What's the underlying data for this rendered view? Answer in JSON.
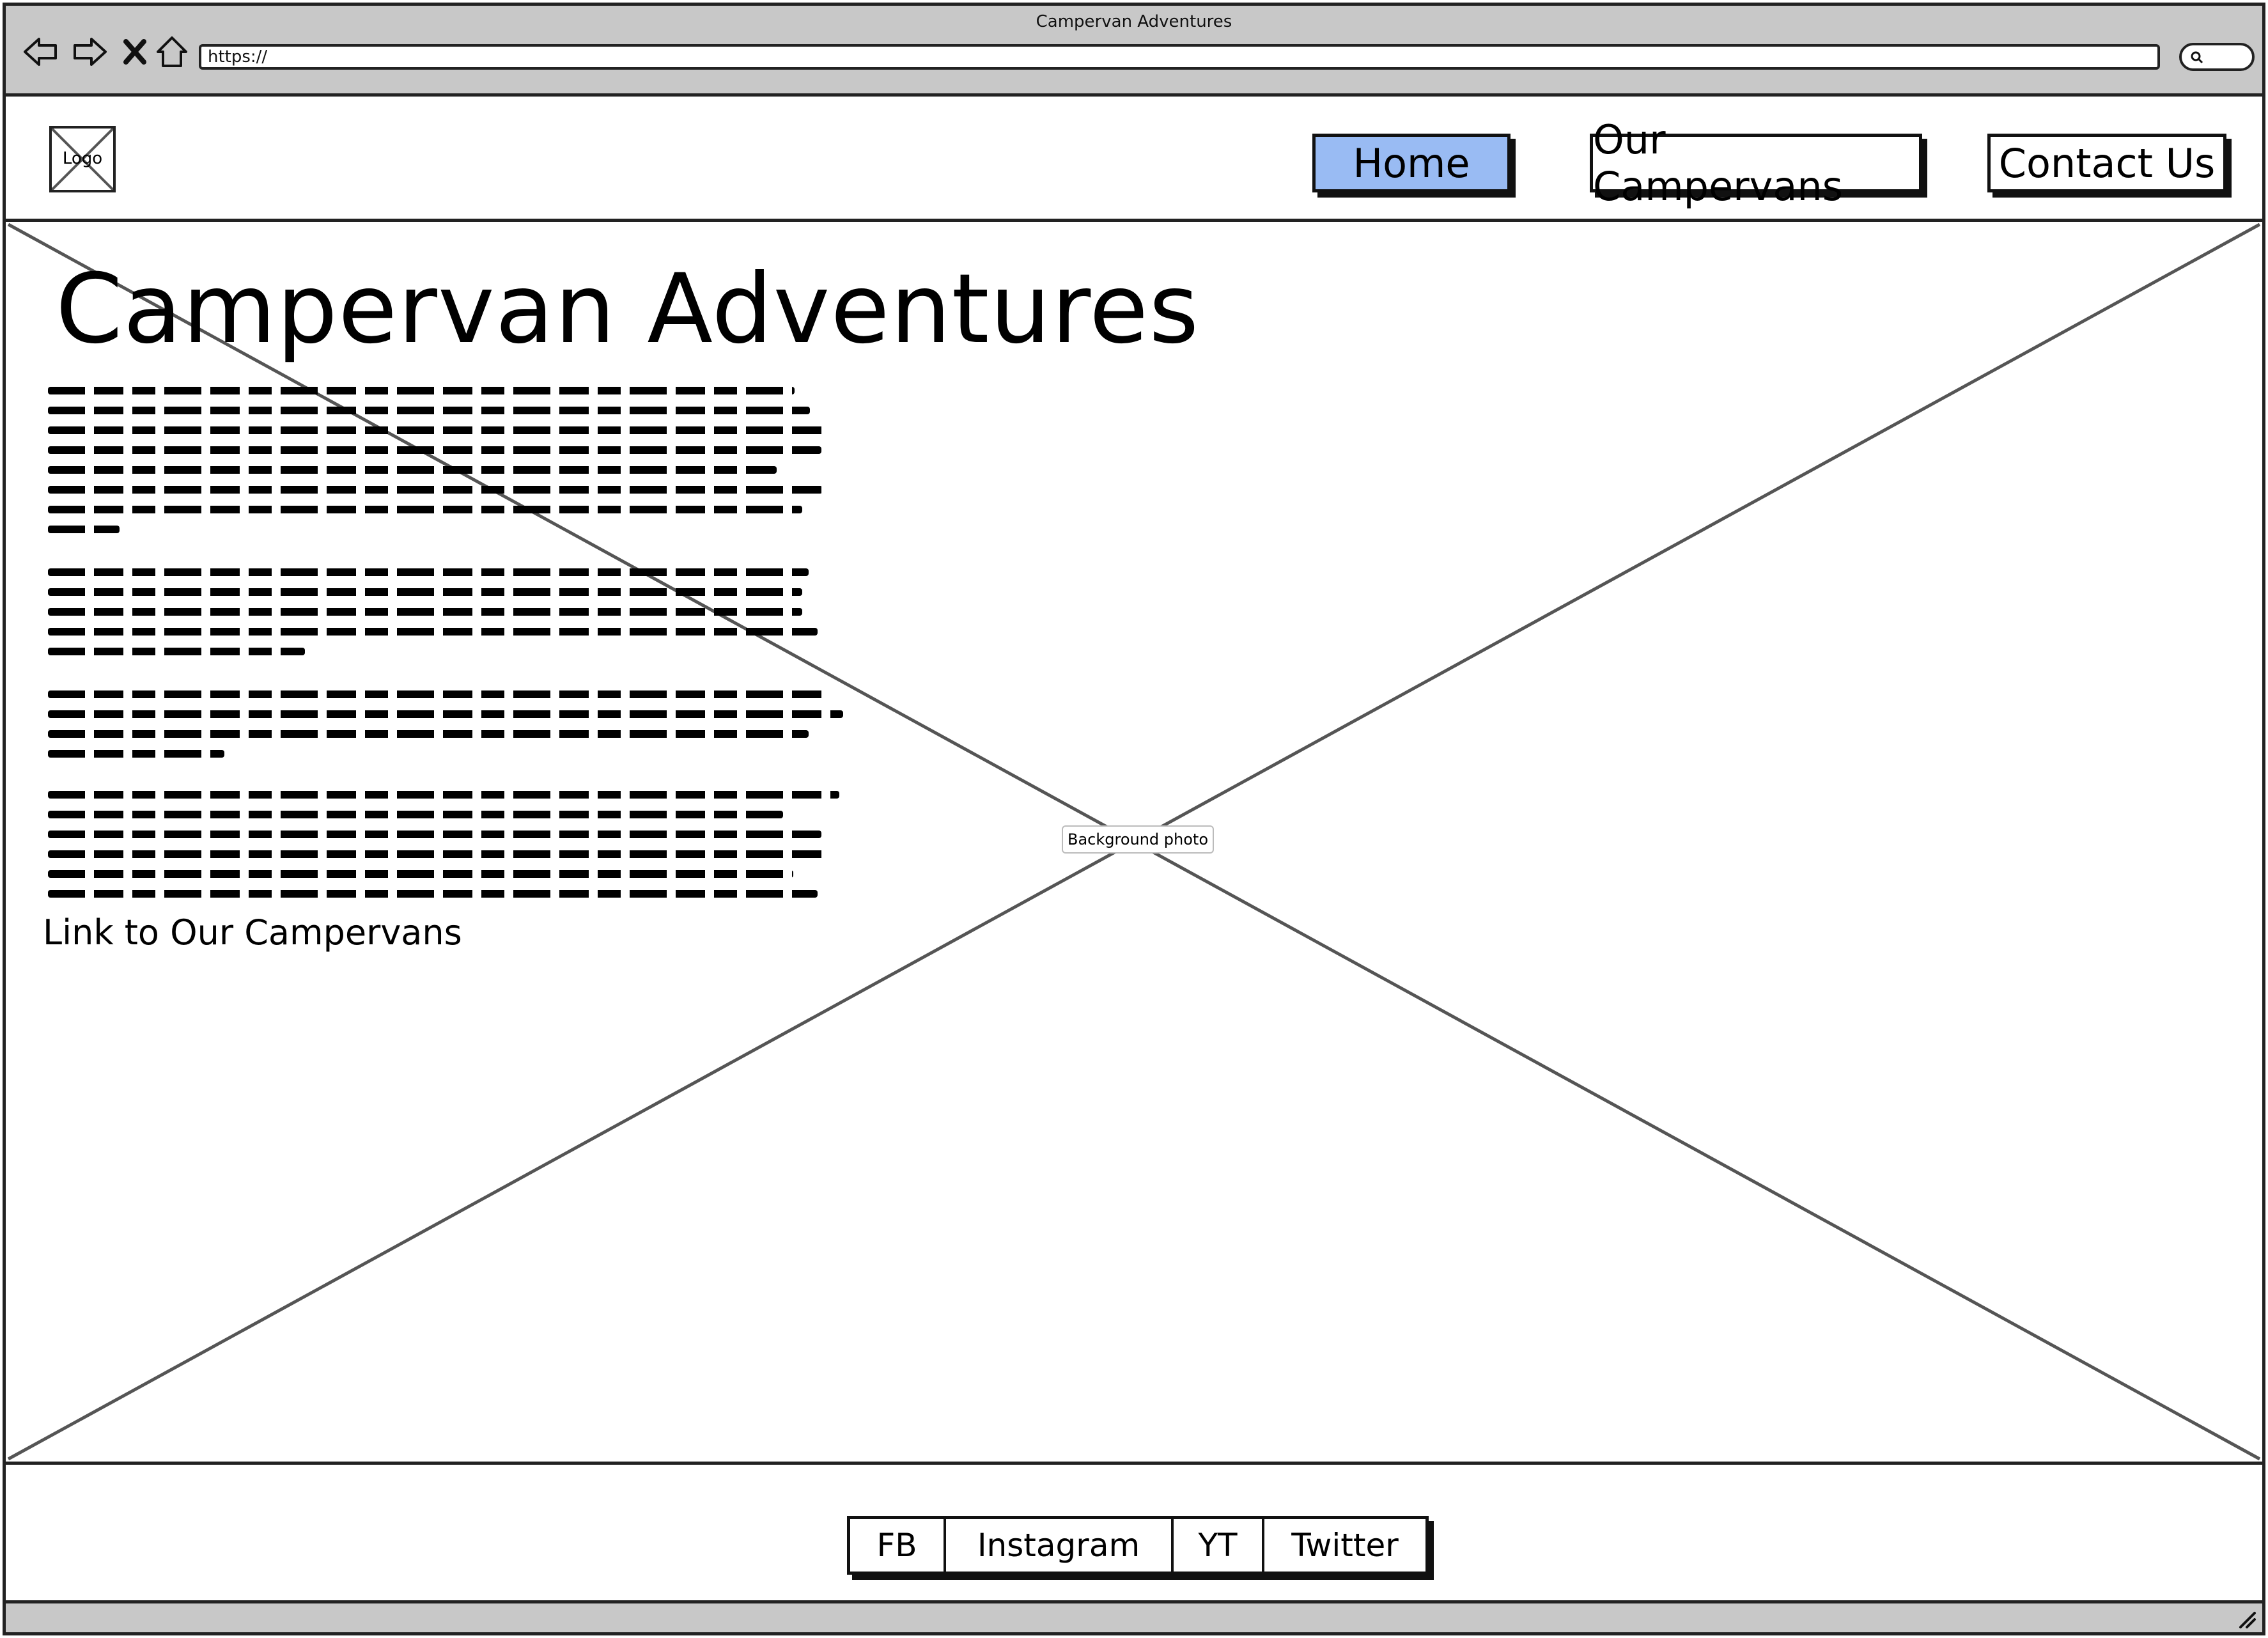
{
  "window": {
    "title": "Campervan Adventures",
    "url": "https://"
  },
  "browser_controls": [
    "back-icon",
    "forward-icon",
    "close-icon",
    "home-icon",
    "search-icon"
  ],
  "header": {
    "logo_label": "Logo",
    "nav": [
      {
        "label": "Home",
        "active": true
      },
      {
        "label": "Our Campervans",
        "active": false
      },
      {
        "label": "Contact Us",
        "active": false
      }
    ],
    "active_color": "#99bbf3"
  },
  "hero": {
    "title": "Campervan Adventures",
    "background_label": "Background photo",
    "link_text": "Link to Our Campervans"
  },
  "footer": {
    "social": [
      "FB",
      "Instagram",
      "YT",
      "Twitter"
    ]
  }
}
